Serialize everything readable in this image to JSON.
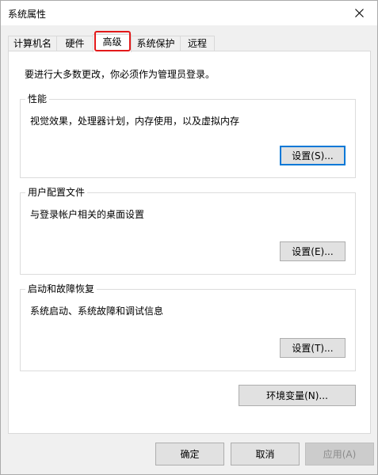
{
  "window": {
    "title": "系统属性"
  },
  "tabs": [
    {
      "label": "计算机名",
      "active": false
    },
    {
      "label": "硬件",
      "active": false
    },
    {
      "label": "高级",
      "active": true
    },
    {
      "label": "系统保护",
      "active": false
    },
    {
      "label": "远程",
      "active": false
    }
  ],
  "panel": {
    "admin_note": "要进行大多数更改，你必须作为管理员登录。",
    "performance": {
      "title": "性能",
      "description": "视觉效果，处理器计划，内存使用，以及虚拟内存",
      "button_label": "设置(S)..."
    },
    "user_profiles": {
      "title": "用户配置文件",
      "description": "与登录帐户相关的桌面设置",
      "button_label": "设置(E)..."
    },
    "startup_recovery": {
      "title": "启动和故障恢复",
      "description": "系统启动、系统故障和调试信息",
      "button_label": "设置(T)..."
    },
    "env_button_label": "环境变量(N)..."
  },
  "footer": {
    "ok_label": "确定",
    "cancel_label": "取消",
    "apply_label": "应用(A)"
  },
  "colors": {
    "highlight_box": "#e3191a",
    "focus_border": "#0078d7"
  },
  "icons": {
    "close": "close-icon"
  }
}
